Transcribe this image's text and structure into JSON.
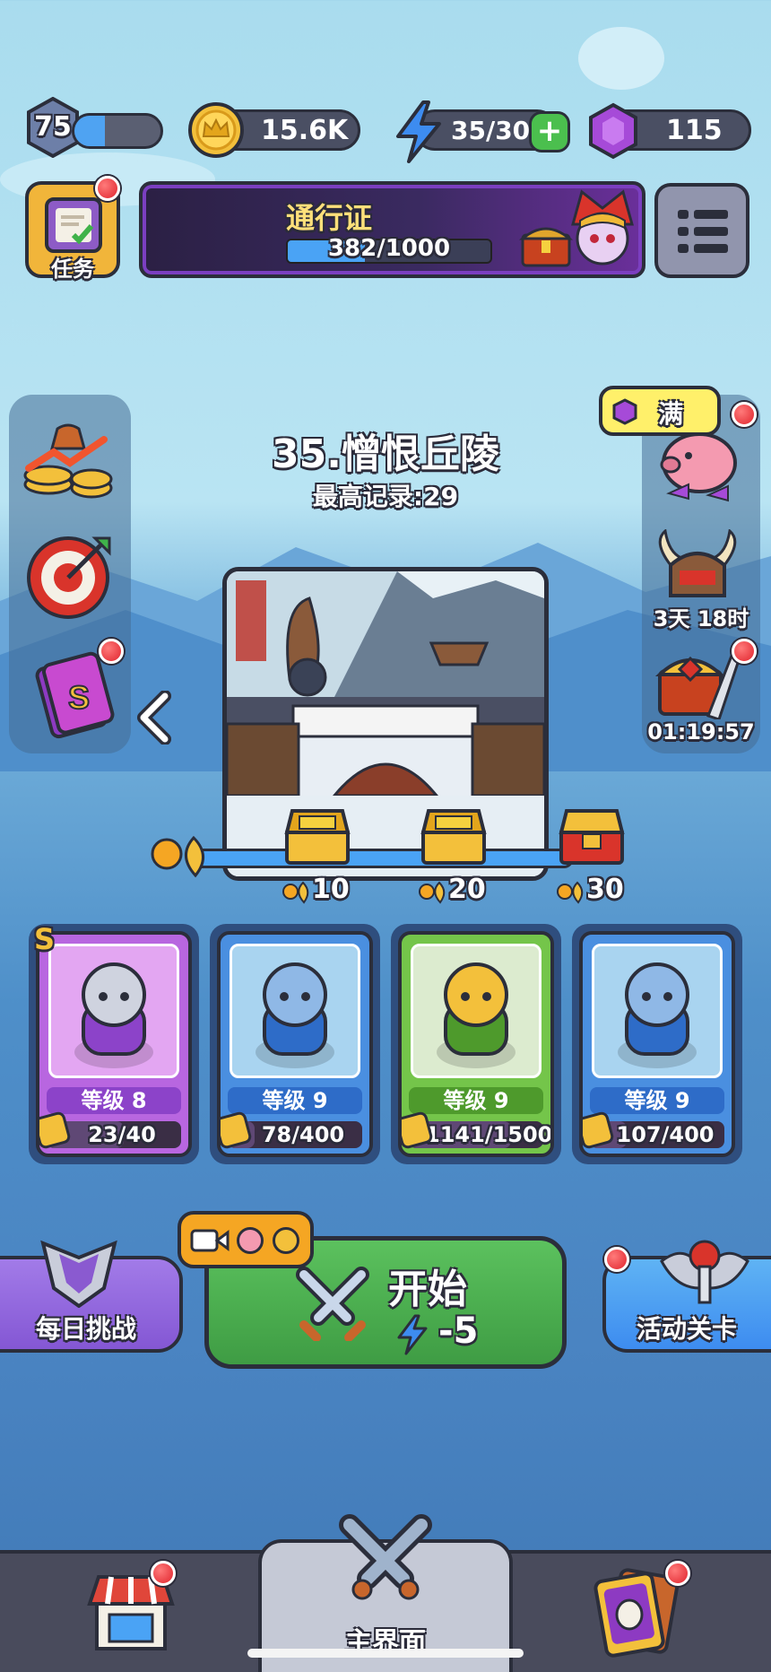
{
  "top_bar": {
    "level": "75",
    "xp_progress": 0.35,
    "coins": "15.6K",
    "energy": "35/30",
    "gems": "115"
  },
  "quest_button": {
    "label": "任务"
  },
  "pass": {
    "title": "通行证",
    "progress_text": "382/1000",
    "progress": 0.382
  },
  "stage": {
    "title": "35.憎恨丘陵",
    "best_record": "最高记录:29"
  },
  "piggy_bank": {
    "status": "满"
  },
  "event_timer": "3天 18时",
  "chest_timer": "01:19:57",
  "stage_chests": [
    {
      "label": "10"
    },
    {
      "label": "20"
    },
    {
      "label": "30"
    }
  ],
  "heroes": [
    {
      "level": "等级 8",
      "shards": "23/40",
      "rarity": "S",
      "color": "#b866e0",
      "level_color": "#8c43c9",
      "shard_progress": 0.575
    },
    {
      "level": "等级 9",
      "shards": "78/400",
      "color": "#4a8fe0",
      "level_color": "#2e6cc8",
      "shard_progress": 0.195
    },
    {
      "level": "等级 9",
      "shards": "1141/1500",
      "color": "#74c54a",
      "level_color": "#4e9a2c",
      "shard_progress": 0.76
    },
    {
      "level": "等级 9",
      "shards": "107/400",
      "color": "#4a8fe0",
      "level_color": "#2e6cc8",
      "shard_progress": 0.2675
    }
  ],
  "buttons": {
    "daily_challenge": "每日挑战",
    "start": "开始",
    "start_cost": "-5",
    "event_stage": "活动关卡"
  },
  "nav": {
    "home_label": "主界面"
  },
  "colors": {
    "accent_green": "#4caf50",
    "accent_purple": "#8c43c9",
    "gold": "#f3c03b",
    "energy_blue": "#3d8cf0"
  }
}
